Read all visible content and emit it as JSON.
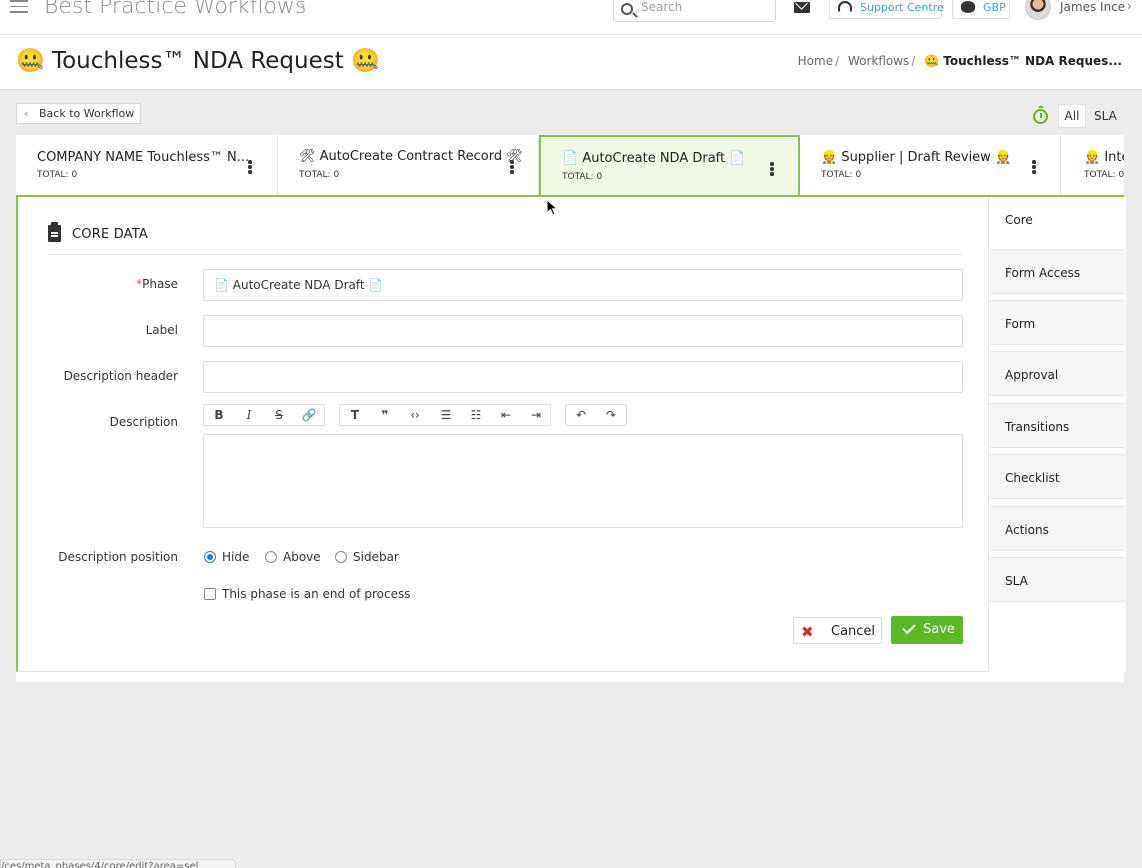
{
  "topbar": {
    "app_title": "Best Practice Workflows",
    "search_placeholder": "Search",
    "support_label": "Support Centre",
    "currency_label": "GBP",
    "user_name": "James Ince"
  },
  "header": {
    "title": "🤐 Touchless™ NDA Request 🤐",
    "breadcrumb": [
      "Home",
      "Workflows",
      "🤐 Touchless™ NDA Reques..."
    ]
  },
  "back_button_label": "Back to Workflow",
  "filters": {
    "all": "All",
    "sla": "SLA"
  },
  "phases": [
    {
      "name": "COMPANY NAME Touchless™ N...",
      "total": "TOTAL: 0"
    },
    {
      "name": "🛠 AutoCreate Contract Record 🛠",
      "total": "TOTAL: 0"
    },
    {
      "name": "📄 AutoCreate NDA Draft 📄",
      "total": "TOTAL: 0"
    },
    {
      "name": "👷 Supplier | Draft Review 👷",
      "total": "TOTAL: 0"
    },
    {
      "name": "👷 Inter",
      "total": "TOTAL: 0"
    }
  ],
  "form": {
    "section_title": "CORE DATA",
    "phase_label": "Phase",
    "phase_required": "*",
    "phase_value": "📄 AutoCreate NDA Draft 📄",
    "label_label": "Label",
    "label_value": "",
    "desc_header_label": "Description header",
    "desc_header_value": "",
    "description_label": "Description",
    "desc_position_label": "Description position",
    "desc_position_options": [
      "Hide",
      "Above",
      "Sidebar"
    ],
    "desc_position_selected": "Hide",
    "end_process_label": "This phase is an end of process",
    "cancel_label": "Cancel",
    "save_label": "Save"
  },
  "toolbar_icons": [
    "bold-icon",
    "italic-icon",
    "strikethrough-icon",
    "link-icon",
    "heading-icon",
    "quote-icon",
    "code-icon",
    "bullet-list-icon",
    "numbered-list-icon",
    "outdent-icon",
    "indent-icon",
    "undo-icon",
    "redo-icon"
  ],
  "side_nav": [
    "Core",
    "Form Access",
    "Form",
    "Approval",
    "Transitions",
    "Checklist",
    "Actions",
    "SLA"
  ],
  "side_nav_active": "Core",
  "status_url": "/ces/meta_phases/4/core/edit?area=sel"
}
